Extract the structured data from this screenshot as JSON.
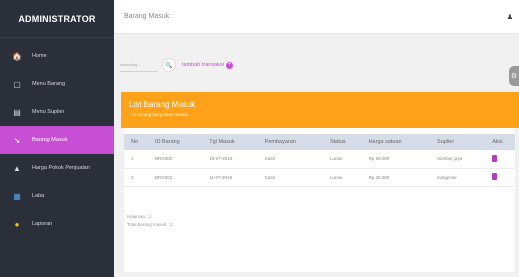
{
  "sidebar": {
    "brand": "ADMINISTRATOR",
    "items": [
      {
        "label": "Home",
        "icon": "home-icon",
        "glyph": "🏠"
      },
      {
        "label": "Menu Barang",
        "icon": "clipboard-icon",
        "glyph": "▢"
      },
      {
        "label": "Menu Suplier",
        "icon": "list-icon",
        "glyph": "▤"
      },
      {
        "label": "Barang Masuk",
        "icon": "inbox-icon",
        "glyph": "↘",
        "active": true
      },
      {
        "label": "Harga Pokok Penjualan",
        "icon": "tag-icon",
        "glyph": "▲"
      },
      {
        "label": "Laba",
        "icon": "chart-icon",
        "glyph": "▦"
      },
      {
        "label": "Laporan",
        "icon": "report-icon",
        "glyph": "●"
      }
    ]
  },
  "header": {
    "title": "Barang Masuk",
    "user_glyph": "♟"
  },
  "toolbar": {
    "search_placeholder": "searching...",
    "search_glyph": "🔍",
    "add_label": "tambah transaksi",
    "add_glyph": "+"
  },
  "panel": {
    "title": "List Barang Masuk",
    "subtitle": "List barang yang telah masuk"
  },
  "table": {
    "headers": [
      "No",
      "ID Barang",
      "Tgl Masuk",
      "Pembayaran",
      "Status",
      "Harga satuan",
      "Suplier",
      "Aksi"
    ],
    "rows": [
      [
        "1",
        "BRG002",
        "18-07-2019",
        "Cash",
        "Lunas",
        "Rp 50.000",
        "Sumber jaya"
      ],
      [
        "2",
        "BRG002",
        "11-07-2019",
        "Cash",
        "Lunas",
        "Rp 25.000",
        "indogrosir"
      ]
    ]
  },
  "footer": {
    "page_label": "Halaman : 1",
    "total_label": "Total barang masuk : 2"
  },
  "colors": {
    "accent": "#c74fd4",
    "header_orange": "#ffa21a",
    "sidebar_bg": "#2b2f3a"
  }
}
